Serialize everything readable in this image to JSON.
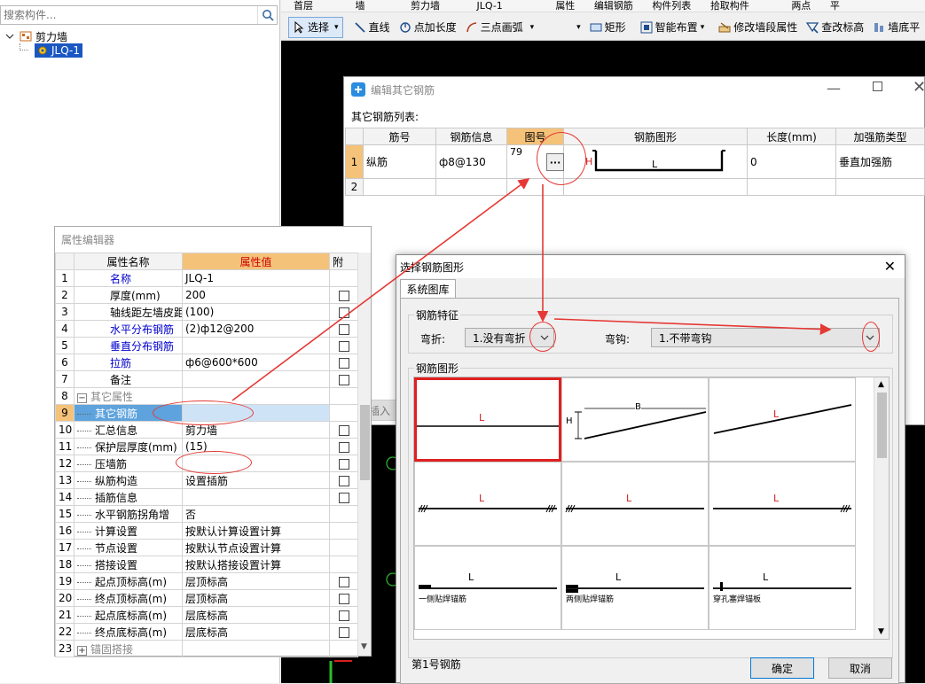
{
  "tree": {
    "search_placeholder": "搜索构件...",
    "group_label": "剪力墙",
    "item_label": "JLQ-1"
  },
  "top_toolbar": {
    "items": [
      "首层",
      "墙",
      "剪力墙",
      "JLQ-1",
      "属性",
      "编辑钢筋",
      "构件列表",
      "拾取构件",
      "两点",
      "平"
    ]
  },
  "toolbar": {
    "select": "选择",
    "line": "直线",
    "point_length": "点加长度",
    "arc": "三点画弧",
    "rect": "矩形",
    "smart": "智能布置",
    "modify_segment": "修改墙段属性",
    "check_elevation": "查改标高",
    "wall_bottom": "墙底平"
  },
  "edit_dialog": {
    "title": "编辑其它钢筋",
    "list_label": "其它钢筋列表:",
    "columns": [
      "筋号",
      "钢筋信息",
      "图号",
      "钢筋图形",
      "长度(mm)",
      "加强筋类型"
    ],
    "rows": [
      {
        "num": "1",
        "name": "纵筋",
        "info": "ф8@130",
        "fig": "79",
        "shape_h": "H",
        "shape_l": "L",
        "length": "0",
        "type": "垂直加强筋"
      },
      {
        "num": "2",
        "name": "",
        "info": "",
        "fig": "",
        "length": "",
        "type": ""
      }
    ],
    "more_btn": "···",
    "insert_btn": "插入"
  },
  "prop_editor": {
    "title": "属性编辑器",
    "col_name": "属性名称",
    "col_value": "属性值",
    "col_extra": "附",
    "rows": [
      {
        "n": "1",
        "name": "名称",
        "value": "JLQ-1",
        "blue": true,
        "chk": false
      },
      {
        "n": "2",
        "name": "厚度(mm)",
        "value": "200",
        "chk": true
      },
      {
        "n": "3",
        "name": "轴线距左墙皮距离",
        "value": "(100)",
        "chk": true
      },
      {
        "n": "4",
        "name": "水平分布钢筋",
        "value": "(2)ф12@200",
        "blue": true,
        "chk": true
      },
      {
        "n": "5",
        "name": "垂直分布钢筋",
        "value": "",
        "blue": true,
        "chk": true
      },
      {
        "n": "6",
        "name": "拉筋",
        "value": "ф6@600*600",
        "blue": true,
        "chk": true
      },
      {
        "n": "7",
        "name": "备注",
        "value": "",
        "chk": true
      },
      {
        "n": "8",
        "name": "其它属性",
        "value": "",
        "group": true
      },
      {
        "n": "9",
        "name": "其它钢筋",
        "value": "",
        "sel": true,
        "indent": true
      },
      {
        "n": "10",
        "name": "汇总信息",
        "value": "剪力墙",
        "chk": true,
        "indent": true
      },
      {
        "n": "11",
        "name": "保护层厚度(mm)",
        "value": "(15)",
        "chk": true,
        "indent": true
      },
      {
        "n": "12",
        "name": "压墙筋",
        "value": "",
        "chk": true,
        "indent": true
      },
      {
        "n": "13",
        "name": "纵筋构造",
        "value": "设置插筋",
        "chk": true,
        "indent": true
      },
      {
        "n": "14",
        "name": "插筋信息",
        "value": "",
        "chk": true,
        "indent": true
      },
      {
        "n": "15",
        "name": "水平钢筋拐角增",
        "value": "否",
        "indent": true
      },
      {
        "n": "16",
        "name": "计算设置",
        "value": "按默认计算设置计算",
        "indent": true
      },
      {
        "n": "17",
        "name": "节点设置",
        "value": "按默认节点设置计算",
        "indent": true
      },
      {
        "n": "18",
        "name": "搭接设置",
        "value": "按默认搭接设置计算",
        "indent": true
      },
      {
        "n": "19",
        "name": "起点顶标高(m)",
        "value": "层顶标高",
        "chk": true,
        "indent": true
      },
      {
        "n": "20",
        "name": "终点顶标高(m)",
        "value": "层顶标高",
        "chk": true,
        "indent": true
      },
      {
        "n": "21",
        "name": "起点底标高(m)",
        "value": "层底标高",
        "chk": true,
        "indent": true
      },
      {
        "n": "22",
        "name": "终点底标高(m)",
        "value": "层底标高",
        "chk": true,
        "indent": true
      },
      {
        "n": "23",
        "name": "锚固搭接",
        "value": "",
        "group": true,
        "plus": true
      }
    ]
  },
  "shape_dialog": {
    "title": "选择钢筋图形",
    "tab": "系统图库",
    "feature_group": "钢筋特征",
    "bend_label": "弯折:",
    "bend_value": "1.没有弯折",
    "hook_label": "弯钩:",
    "hook_value": "1.不带弯钩",
    "shape_group": "钢筋图形",
    "cells": [
      {
        "l": "L"
      },
      {
        "h": "H",
        "b": "B"
      },
      {
        "l": "L"
      },
      {
        "l": "L"
      },
      {
        "l": "L"
      },
      {
        "l": "L"
      },
      {
        "l": "L",
        "cap": "一侧贴焊锚筋"
      },
      {
        "l": "L",
        "cap": "两侧贴焊锚筋"
      },
      {
        "l": "L",
        "cap": "穿孔塞焊锚板"
      }
    ],
    "status": "第1号钢筋",
    "ok": "确定",
    "cancel": "取消"
  }
}
